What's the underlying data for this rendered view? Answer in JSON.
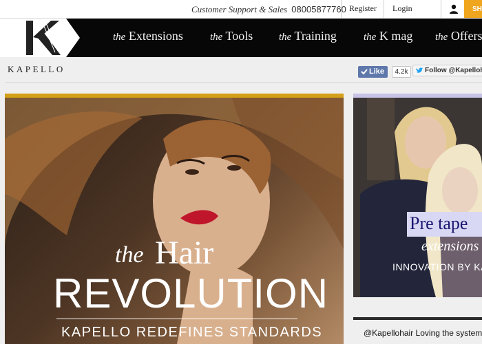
{
  "topbar": {
    "support_label": "Customer Support & Sales",
    "support_number": "08005877760",
    "register_label": "Register",
    "login_label": "Login",
    "shop_label": "SHOP"
  },
  "brand": {
    "name": "KAPELLO"
  },
  "nav": {
    "items": [
      {
        "the": "the",
        "label": "Extensions"
      },
      {
        "the": "the",
        "label": "Tools"
      },
      {
        "the": "the",
        "label": "Training"
      },
      {
        "the": "the",
        "label": "K mag"
      },
      {
        "the": "the",
        "label": "Offers"
      }
    ]
  },
  "social": {
    "like_label": "Like",
    "like_count": "4.2k",
    "follow_label": "Follow @Kapellohair"
  },
  "hero": {
    "the": "the",
    "hair": "Hair",
    "revolution": "REVOLUTION",
    "tagline": "KAPELLO REDEFINES STANDARDS"
  },
  "side_promo": {
    "title": "Pre tape",
    "subtitle": "extensions",
    "innovation": "INNOVATION BY KA"
  },
  "tweet": {
    "text": "@Kapellohair Loving the systems"
  },
  "colors": {
    "accent_gold": "#d4a017",
    "accent_lavender": "#c7c3e6",
    "facebook": "#5f78ab",
    "shop": "#f0a51e"
  }
}
